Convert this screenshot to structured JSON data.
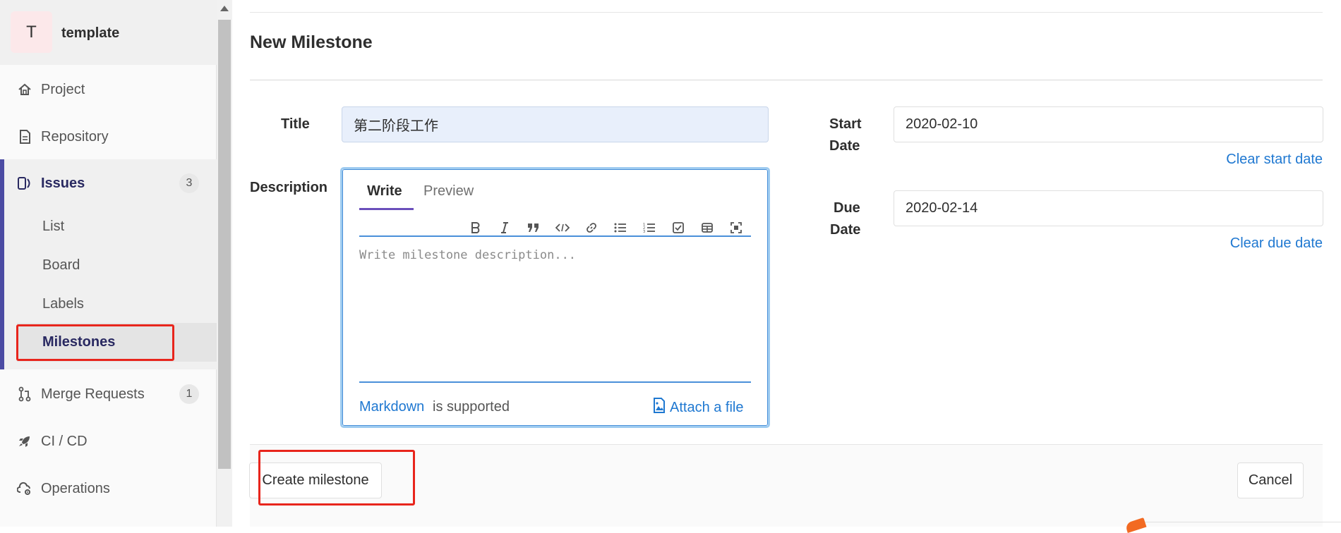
{
  "project": {
    "avatar_letter": "T",
    "name": "template"
  },
  "sidebar": {
    "items": [
      {
        "label": "Project",
        "icon": "home-icon"
      },
      {
        "label": "Repository",
        "icon": "document-icon"
      },
      {
        "label": "Issues",
        "icon": "issues-icon",
        "count": "3"
      },
      {
        "label": "Merge Requests",
        "icon": "merge-request-icon",
        "count": "1"
      },
      {
        "label": "CI / CD",
        "icon": "rocket-icon"
      },
      {
        "label": "Operations",
        "icon": "cloud-gear-icon"
      }
    ],
    "issues_sub": [
      {
        "label": "List"
      },
      {
        "label": "Board"
      },
      {
        "label": "Labels"
      },
      {
        "label": "Milestones"
      }
    ]
  },
  "page": {
    "title": "New Milestone"
  },
  "form": {
    "title_label": "Title",
    "title_value": "第二阶段工作",
    "description_label": "Description",
    "tabs": {
      "write": "Write",
      "preview": "Preview"
    },
    "toolbar_icons": [
      "bold-icon",
      "italic-icon",
      "quote-icon",
      "code-icon",
      "link-icon",
      "bullet-list-icon",
      "numbered-list-icon",
      "task-list-icon",
      "table-icon",
      "fullscreen-icon"
    ],
    "description_placeholder": "Write milestone description...",
    "markdown_link": "Markdown",
    "markdown_rest": "is supported",
    "attach_label": "Attach a file",
    "start_date_label_1": "Start",
    "start_date_label_2": "Date",
    "start_date_value": "2020-02-10",
    "clear_start": "Clear start date",
    "due_date_label_1": "Due",
    "due_date_label_2": "Date",
    "due_date_value": "2020-02-14",
    "clear_due": "Clear due date"
  },
  "footer": {
    "create_label": "Create milestone",
    "cancel_label": "Cancel"
  },
  "colors": {
    "accent": "#292961",
    "link": "#1f78d1",
    "highlight": "#e8251c",
    "tab_underline": "#6b4fbb"
  }
}
